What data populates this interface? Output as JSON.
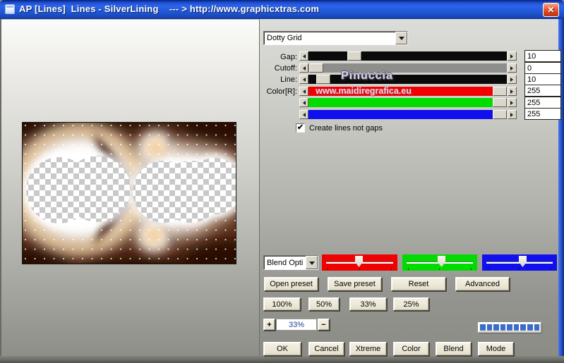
{
  "window": {
    "title": "AP [Lines]  Lines - SilverLining    --- > http://www.graphicxtras.com",
    "close": "✕"
  },
  "watermarks": {
    "name": "Pinuccia",
    "site": "www.maidiregrafica.eu"
  },
  "preset_dropdown": {
    "value": "Dotty Grid"
  },
  "blend_dropdown": {
    "value": "Blend Opti"
  },
  "sliders": [
    {
      "label": "Gap:",
      "value": "10"
    },
    {
      "label": "Cutoff:",
      "value": "0"
    },
    {
      "label": "Line:",
      "value": "10"
    },
    {
      "label": "Color[R]:",
      "value": "255"
    },
    {
      "label": "",
      "value": "255"
    },
    {
      "label": "",
      "value": "255"
    }
  ],
  "checkbox": {
    "label": "Create lines not gaps",
    "checked": true,
    "mark": "✔"
  },
  "preset_buttons": {
    "open": "Open preset",
    "save": "Save preset",
    "reset": "Reset",
    "advanced": "Advanced"
  },
  "zoom_buttons": {
    "b100": "100%",
    "b50": "50%",
    "b33": "33%",
    "b25": "25%"
  },
  "zoom_stepper": {
    "plus": "+",
    "value": "33%",
    "minus": "−"
  },
  "progress": {
    "segments": 9
  },
  "action_buttons": {
    "ok": "OK",
    "cancel": "Cancel",
    "xtreme": "Xtreme",
    "color": "Color",
    "blend": "Blend",
    "mode": "Mode"
  },
  "colors": {
    "titlebar": "#2158d8",
    "close_button": "#d6421e",
    "slider_red": "#f00000",
    "slider_green": "#00dc00",
    "slider_blue": "#1010ee",
    "progress_segment": "#3a6cc8",
    "button_face": "#eeead9"
  }
}
